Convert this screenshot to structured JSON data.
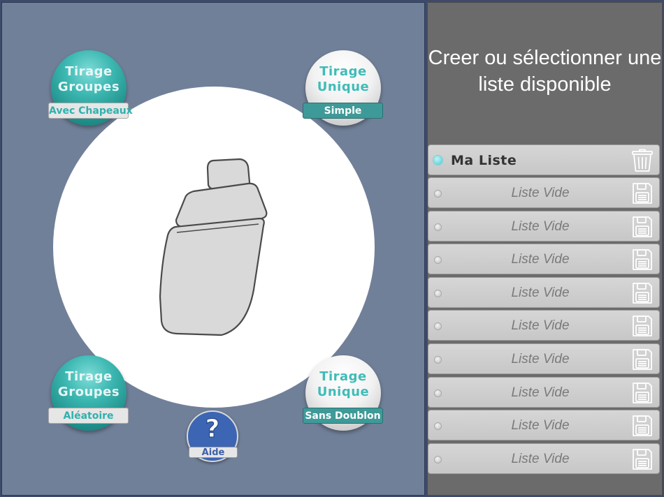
{
  "header": {
    "title": "Creer ou sélectionner une liste disponible"
  },
  "modes": [
    {
      "id": "groups-hats",
      "title": "Tirage Groupes",
      "tag": "Avec Chapeaux",
      "style": "teal"
    },
    {
      "id": "unique-simple",
      "title": "Tirage Unique",
      "tag": "Simple",
      "style": "white"
    },
    {
      "id": "groups-random",
      "title": "Tirage Groupes",
      "tag": "Aléatoire",
      "style": "teal"
    },
    {
      "id": "unique-nodup",
      "title": "Tirage Unique",
      "tag": "Sans Doublon",
      "style": "white"
    }
  ],
  "help": {
    "symbol": "?",
    "label": "Aide"
  },
  "lists": [
    {
      "label": "Ma Liste",
      "active": true,
      "icon": "trash-icon"
    },
    {
      "label": "Liste Vide",
      "active": false,
      "icon": "save-icon"
    },
    {
      "label": "Liste Vide",
      "active": false,
      "icon": "save-icon"
    },
    {
      "label": "Liste Vide",
      "active": false,
      "icon": "save-icon"
    },
    {
      "label": "Liste Vide",
      "active": false,
      "icon": "save-icon"
    },
    {
      "label": "Liste Vide",
      "active": false,
      "icon": "save-icon"
    },
    {
      "label": "Liste Vide",
      "active": false,
      "icon": "save-icon"
    },
    {
      "label": "Liste Vide",
      "active": false,
      "icon": "save-icon"
    },
    {
      "label": "Liste Vide",
      "active": false,
      "icon": "save-icon"
    },
    {
      "label": "Liste Vide",
      "active": false,
      "icon": "save-icon"
    }
  ],
  "colors": {
    "accent_teal": "#3db8b2",
    "panel_left": "#718099",
    "panel_right": "#6b6b6b",
    "help_blue": "#3c66b4"
  }
}
